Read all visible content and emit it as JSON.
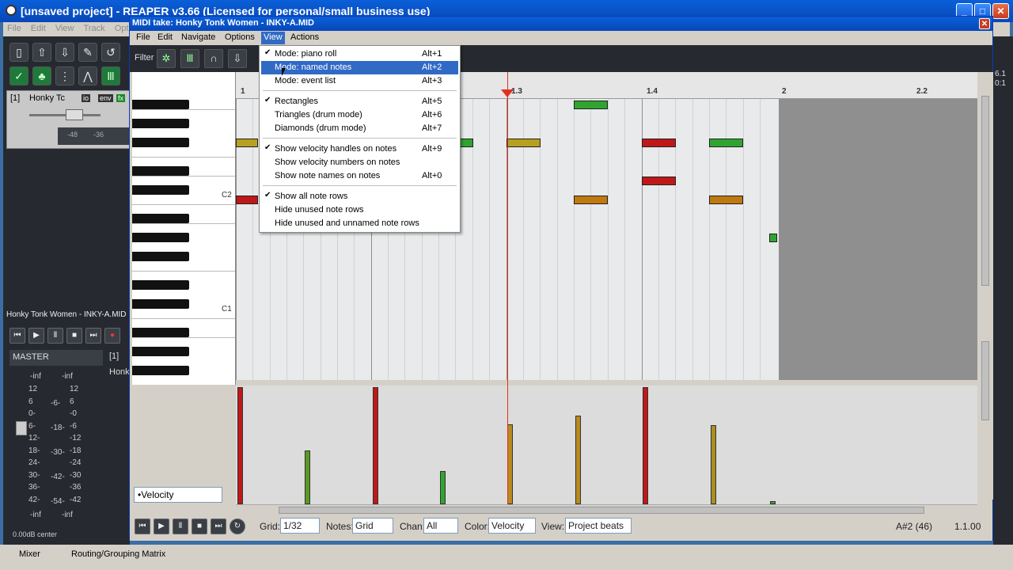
{
  "reaper": {
    "title": "[unsaved project] - REAPER v3.66 (Licensed for personal/small business use)",
    "menu": [
      "File",
      "Edit",
      "View",
      "Track",
      "Opti"
    ],
    "track_name": "Honky Tc",
    "transport_title": "Honky Tonk Women - INKY-A.MID",
    "master_label": "MASTER",
    "track_num": "[1]",
    "track2_name": "Honk",
    "vu_top": [
      "-inf",
      "-inf"
    ],
    "vu_scale": [
      "12",
      "6",
      "0-",
      "6-",
      "12-",
      "18-",
      "24-",
      "30-",
      "36-",
      "42-"
    ],
    "vu_scale_right": [
      "12",
      "6",
      "-0",
      "-6",
      "-12",
      "-18",
      "-24",
      "-30",
      "-36",
      "-42"
    ],
    "vu_mid": [
      "-6-",
      "-18-",
      "-30-",
      "-42-",
      "-54-"
    ],
    "vu_bottom": [
      "-inf",
      "-inf"
    ],
    "pan_readout": "0.00dB center",
    "tab_mixer": "Mixer",
    "tab_routing": "Routing/Grouping Matrix",
    "right_nums": [
      "6.1",
      "0:1"
    ],
    "fader_readout": [
      "-48",
      "-36"
    ]
  },
  "midi": {
    "title": "MIDI take: Honky Tonk Women - INKY-A.MID",
    "menu": [
      "File",
      "Edit",
      "Navigate",
      "Options",
      "View",
      "Actions"
    ],
    "filter_label": "Filter",
    "key_labels": {
      "c2": "C2",
      "c1": "C1"
    },
    "ruler": [
      "1",
      "1.3",
      "1.4",
      "2",
      "2.2"
    ],
    "lane_select": "•Velocity",
    "bottom": {
      "grid_label": "Grid:",
      "grid_value": "1/32",
      "notes_label": "Notes:",
      "notes_value": "Grid",
      "chan_label": "Chan:",
      "chan_value": "All",
      "color_label": "Color:",
      "color_value": "Velocity",
      "view_label": "View:",
      "view_value": "Project beats",
      "note_readout": "A#2 (46)",
      "pos_readout": "1.1.00"
    }
  },
  "view_menu": {
    "items": [
      {
        "label": "Mode: piano roll",
        "accel": "Alt+1",
        "checked": true
      },
      {
        "label": "Mode: named notes",
        "accel": "Alt+2",
        "checked": false,
        "highlighted": true
      },
      {
        "label": "Mode: event list",
        "accel": "Alt+3",
        "checked": false
      },
      {
        "label": "Rectangles",
        "accel": "Alt+5",
        "checked": true
      },
      {
        "label": "Triangles (drum mode)",
        "accel": "Alt+6",
        "checked": false
      },
      {
        "label": "Diamonds (drum mode)",
        "accel": "Alt+7",
        "checked": false
      },
      {
        "label": "Show velocity handles on notes",
        "accel": "Alt+9",
        "checked": true
      },
      {
        "label": "Show velocity numbers on notes",
        "accel": "",
        "checked": false
      },
      {
        "label": "Show note names on notes",
        "accel": "Alt+0",
        "checked": false
      },
      {
        "label": "Show all note rows",
        "accel": "",
        "checked": true
      },
      {
        "label": "Hide unused note rows",
        "accel": "",
        "checked": false
      },
      {
        "label": "Hide unused and unnamed note rows",
        "accel": "",
        "checked": false
      }
    ],
    "check_glyph": "✔"
  },
  "colors": {
    "note_low": "#2fa52f",
    "note_mid": "#b8a020",
    "note_orange": "#c07810",
    "note_high": "#c01818",
    "accent": "#316ac5"
  }
}
